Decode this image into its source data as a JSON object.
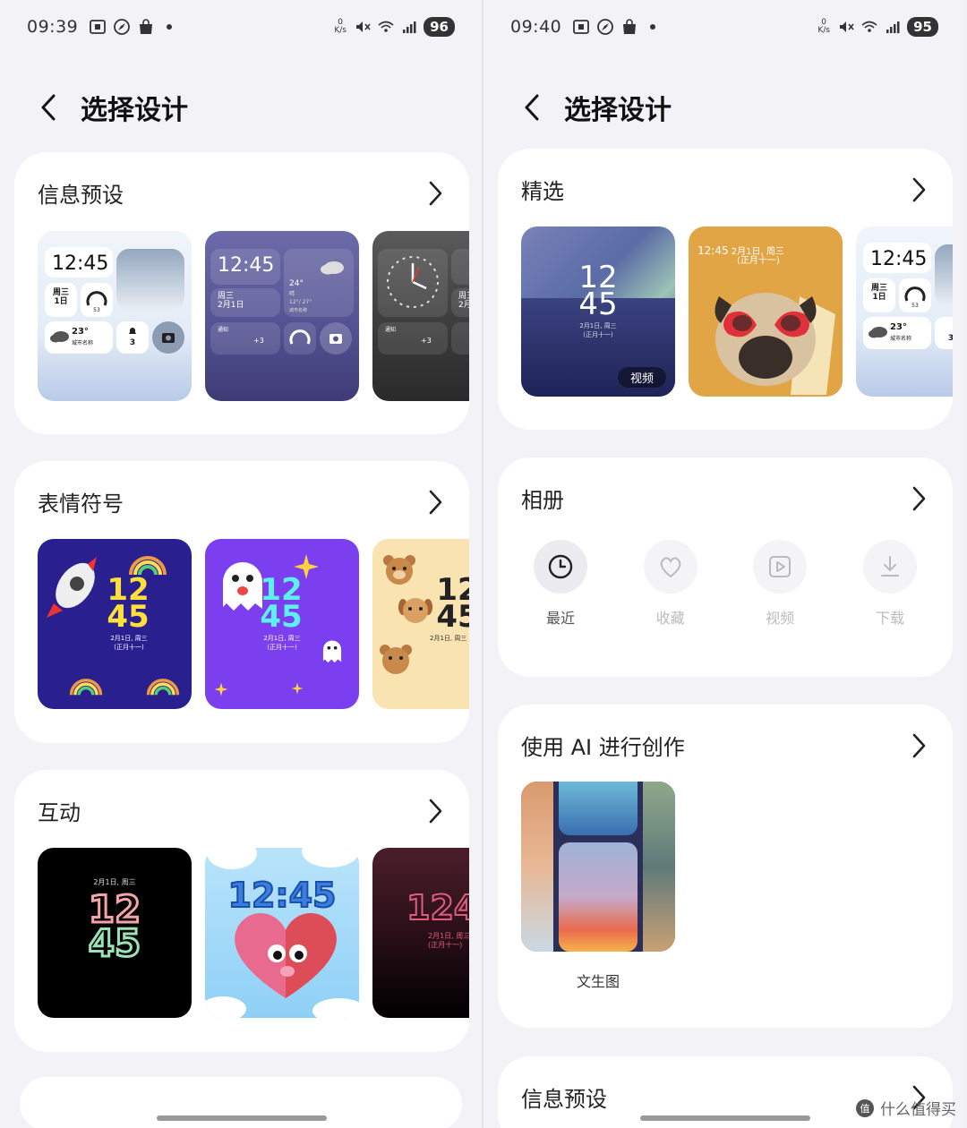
{
  "left": {
    "status": {
      "time": "09:39",
      "battery": "96",
      "speed_top": "0",
      "speed_unit": "K/s"
    },
    "header": {
      "title": "选择设计"
    },
    "sections": {
      "info": {
        "title": "信息预设",
        "t1": {
          "time": "12:45",
          "weekday": "周三",
          "date": "1日",
          "gauge": "53",
          "temp": "23°",
          "city": "城市名称",
          "count": "3"
        },
        "t2": {
          "time": "12:45",
          "weekday": "周三",
          "date": "2月1日",
          "temp": "24°",
          "cond": "晴",
          "range": "12°/ 27°",
          "city": "城市名称",
          "notice": "通知",
          "more": "+3",
          "gauge": "53"
        },
        "t3": {
          "weekday": "周三",
          "date": "2月",
          "notice": "通知",
          "more": "+3"
        }
      },
      "emoji": {
        "title": "表情符号",
        "t1": {
          "hh": "12",
          "mm": "45",
          "date": "2月1日, 周三",
          "lunar": "(正月十一)"
        },
        "t2": {
          "hh": "12",
          "mm": "45",
          "date": "2月1日, 周三",
          "lunar": "(正月十一)"
        },
        "t3": {
          "hh": "12",
          "mm": "45",
          "date": "2月1日, 周三"
        }
      },
      "interact": {
        "title": "互动",
        "t1": {
          "date": "2月1日, 周三",
          "hh": "12",
          "mm": "45"
        },
        "t2": {
          "time": "12:45"
        },
        "t3": {
          "time": "124",
          "date": "2月1日, 周三",
          "lunar": "(正月十一)"
        }
      }
    }
  },
  "right": {
    "status": {
      "time": "09:40",
      "battery": "95",
      "speed_top": "0",
      "speed_unit": "K/s"
    },
    "header": {
      "title": "选择设计"
    },
    "sections": {
      "featured": {
        "title": "精选",
        "t1": {
          "hh": "12",
          "mm": "45",
          "date": "2月1日, 周三",
          "lunar": "(正月十一)",
          "badge": "视频"
        },
        "t2": {
          "time": "12:45",
          "date": "2月1日, 周三",
          "lunar": "(正月十一)"
        },
        "t3": {
          "time": "12:45",
          "weekday": "周三",
          "date": "1日",
          "gauge": "53",
          "temp": "23°",
          "city": "城市名称",
          "count": "3"
        }
      },
      "album": {
        "title": "相册",
        "items": [
          {
            "label": "最近",
            "icon": "clock-icon"
          },
          {
            "label": "收藏",
            "icon": "heart-icon"
          },
          {
            "label": "视频",
            "icon": "play-icon"
          },
          {
            "label": "下载",
            "icon": "download-icon"
          }
        ]
      },
      "ai": {
        "title": "使用 AI 进行创作",
        "item_label": "文生图"
      },
      "info": {
        "title": "信息预设"
      }
    }
  },
  "watermark": {
    "text": "什么值得买"
  }
}
